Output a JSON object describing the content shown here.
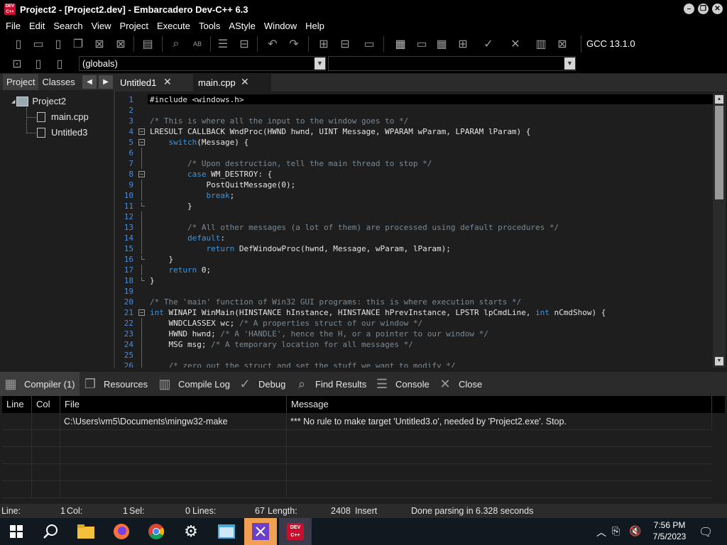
{
  "window": {
    "title": "Project2 - [Project2.dev] - Embarcadero Dev-C++ 6.3",
    "logo_text": "DEV C++"
  },
  "menu": [
    "File",
    "Edit",
    "Search",
    "View",
    "Project",
    "Execute",
    "Tools",
    "AStyle",
    "Window",
    "Help"
  ],
  "toolbar": {
    "compiler": "GCC 13.1.0",
    "scope_combo": "(globals)",
    "function_combo": ""
  },
  "left_panel": {
    "tabs": [
      "Project",
      "Classes"
    ],
    "tree": {
      "project": "Project2",
      "files": [
        "main.cpp",
        "Untitled3"
      ]
    }
  },
  "editor_tabs": [
    {
      "label": "Untitled1"
    },
    {
      "label": "main.cpp"
    }
  ],
  "editor": {
    "lines": [
      {
        "n": "1",
        "code": "#include <windows.h>"
      },
      {
        "n": "2",
        "code": ""
      },
      {
        "n": "3",
        "code": "/* This is where all the input to the window goes to */"
      },
      {
        "n": "4",
        "code": "LRESULT CALLBACK WndProc(HWND hwnd, UINT Message, WPARAM wParam, LPARAM lParam) {"
      },
      {
        "n": "5",
        "code": "    switch(Message) {"
      },
      {
        "n": "6",
        "code": ""
      },
      {
        "n": "7",
        "code": "        /* Upon destruction, tell the main thread to stop */"
      },
      {
        "n": "8",
        "code": "        case WM_DESTROY: {"
      },
      {
        "n": "9",
        "code": "            PostQuitMessage(0);"
      },
      {
        "n": "10",
        "code": "            break;"
      },
      {
        "n": "11",
        "code": "        }"
      },
      {
        "n": "12",
        "code": ""
      },
      {
        "n": "13",
        "code": "        /* All other messages (a lot of them) are processed using default procedures */"
      },
      {
        "n": "14",
        "code": "        default:"
      },
      {
        "n": "15",
        "code": "            return DefWindowProc(hwnd, Message, wParam, lParam);"
      },
      {
        "n": "16",
        "code": "    }"
      },
      {
        "n": "17",
        "code": "    return 0;"
      },
      {
        "n": "18",
        "code": "}"
      },
      {
        "n": "19",
        "code": ""
      },
      {
        "n": "20",
        "code": "/* The 'main' function of Win32 GUI programs: this is where execution starts */"
      },
      {
        "n": "21",
        "code": "int WINAPI WinMain(HINSTANCE hInstance, HINSTANCE hPrevInstance, LPSTR lpCmdLine, int nCmdShow) {"
      },
      {
        "n": "22",
        "code": "    WNDCLASSEX wc; /* A properties struct of our window */"
      },
      {
        "n": "23",
        "code": "    HWND hwnd; /* A 'HANDLE', hence the H, or a pointer to our window */"
      },
      {
        "n": "24",
        "code": "    MSG msg; /* A temporary location for all messages */"
      },
      {
        "n": "25",
        "code": ""
      },
      {
        "n": "26",
        "code": "    /* zero out the struct and set the stuff we want to modify */"
      }
    ]
  },
  "bottom_tabs": [
    {
      "label": "Compiler (1)",
      "icon": "compiler-icon"
    },
    {
      "label": "Resources",
      "icon": "resources-icon"
    },
    {
      "label": "Compile Log",
      "icon": "compile-log-icon"
    },
    {
      "label": "Debug",
      "icon": "debug-icon"
    },
    {
      "label": "Find Results",
      "icon": "find-results-icon"
    },
    {
      "label": "Console",
      "icon": "console-icon"
    },
    {
      "label": "Close",
      "icon": "close-icon"
    }
  ],
  "messages": {
    "columns": [
      "Line",
      "Col",
      "File",
      "Message"
    ],
    "rows": [
      {
        "line": "",
        "col": "",
        "file": "C:\\Users\\vm5\\Documents\\mingw32-make",
        "message": "*** No rule to make target 'Untitled3.o', needed by 'Project2.exe'.  Stop."
      }
    ]
  },
  "status": {
    "line_label": "Line:",
    "line_val": "1",
    "col_label": "Col:",
    "col_val": "1",
    "sel_label": "Sel:",
    "sel_val": "0",
    "lines_label": "Lines:",
    "lines_val": "67",
    "length_label": "Length:",
    "length_val": "2408",
    "mode": "Insert",
    "parse": "Done parsing in 6.328 seconds"
  },
  "taskbar": {
    "time": "7:56 PM",
    "date": "7/5/2023"
  },
  "colors": {
    "keyword": "#3a96dd",
    "comment": "#7a8a96",
    "gutter": "#4f8bd4",
    "bg": "#1e1e1e"
  }
}
